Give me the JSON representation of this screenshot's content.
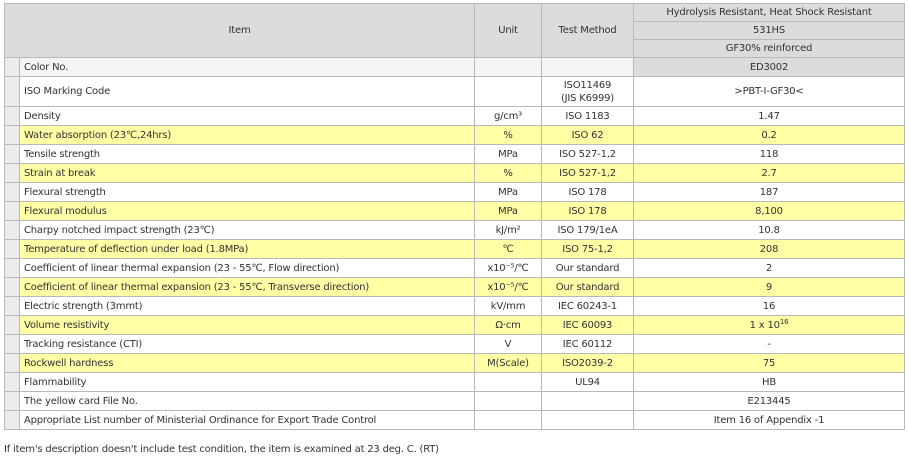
{
  "header": {
    "item": "Item",
    "unit": "Unit",
    "test_method": "Test Method",
    "grade_title": "Hydrolysis Resistant, Heat Shock Resistant",
    "grade_name": "531HS",
    "grade_reinforcement": "GF30% reinforced"
  },
  "rows": [
    {
      "item": "Color No.",
      "unit": "",
      "method": "",
      "value": "ED3002",
      "highlight": "grey"
    },
    {
      "item": "ISO Marking Code",
      "unit": "",
      "method": "ISO11469",
      "method2": "(JIS K6999)",
      "value": ">PBT-I-GF30<",
      "highlight": "none"
    },
    {
      "item": "Density",
      "unit": "g/cm³",
      "method": "ISO 1183",
      "value": "1.47",
      "highlight": "none"
    },
    {
      "item": "Water absorption (23℃,24hrs)",
      "unit": "%",
      "method": "ISO 62",
      "value": "0.2",
      "highlight": "yellow"
    },
    {
      "item": "Tensile strength",
      "unit": "MPa",
      "method": "ISO 527-1,2",
      "value": "118",
      "highlight": "none"
    },
    {
      "item": "Strain at break",
      "unit": "%",
      "method": "ISO 527-1,2",
      "value": "2.7",
      "highlight": "yellow"
    },
    {
      "item": "Flexural strength",
      "unit": "MPa",
      "method": "ISO 178",
      "value": "187",
      "highlight": "none"
    },
    {
      "item": "Flexural modulus",
      "unit": "MPa",
      "method": "ISO 178",
      "value": "8,100",
      "highlight": "yellow"
    },
    {
      "item": "Charpy notched impact strength (23℃)",
      "unit": "kJ/m²",
      "method": "ISO 179/1eA",
      "value": "10.8",
      "highlight": "none"
    },
    {
      "item": "Temperature of deflection under load (1.8MPa)",
      "unit": "℃",
      "method": "ISO 75-1,2",
      "value": "208",
      "highlight": "yellow"
    },
    {
      "item": "Coefficient of linear thermal expansion (23 - 55℃, Flow direction)",
      "unit": "x10⁻⁵/℃",
      "method": "Our standard",
      "value": "2",
      "highlight": "none"
    },
    {
      "item": "Coefficient of linear thermal expansion (23 - 55℃, Transverse direction)",
      "unit": "x10⁻⁵/℃",
      "method": "Our standard",
      "value": "9",
      "highlight": "yellow"
    },
    {
      "item": "Electric strength (3mmt)",
      "unit": "kV/mm",
      "method": "IEC 60243-1",
      "value": "16",
      "highlight": "none"
    },
    {
      "item": "Volume resistivity",
      "unit": "Ω·cm",
      "method": "IEC 60093",
      "value": "1 x 10",
      "value_sup": "16",
      "highlight": "yellow"
    },
    {
      "item": "Tracking resistance (CTI)",
      "unit": "V",
      "method": "IEC 60112",
      "value": "-",
      "highlight": "none"
    },
    {
      "item": "Rockwell hardness",
      "unit": "M(Scale)",
      "method": "ISO2039-2",
      "value": "75",
      "highlight": "yellow"
    },
    {
      "item": "Flammability",
      "unit": "",
      "method": "UL94",
      "value": "HB",
      "highlight": "none"
    },
    {
      "item": "The yellow card File No.",
      "unit": "",
      "method": "",
      "value": "E213445",
      "highlight": "none"
    },
    {
      "item": "Appropriate List number of Ministerial Ordinance for Export Trade Control",
      "unit": "",
      "method": "",
      "value": "Item 16 of Appendix -1",
      "highlight": "none"
    }
  ],
  "footnote": "If item's description doesn't include test condition, the item is examined at 23 deg. C. (RT)",
  "colors": {
    "highlight_yellow": "#ffffa6",
    "header_grey": "#dcdcdc",
    "border": "#b9b9b9"
  }
}
